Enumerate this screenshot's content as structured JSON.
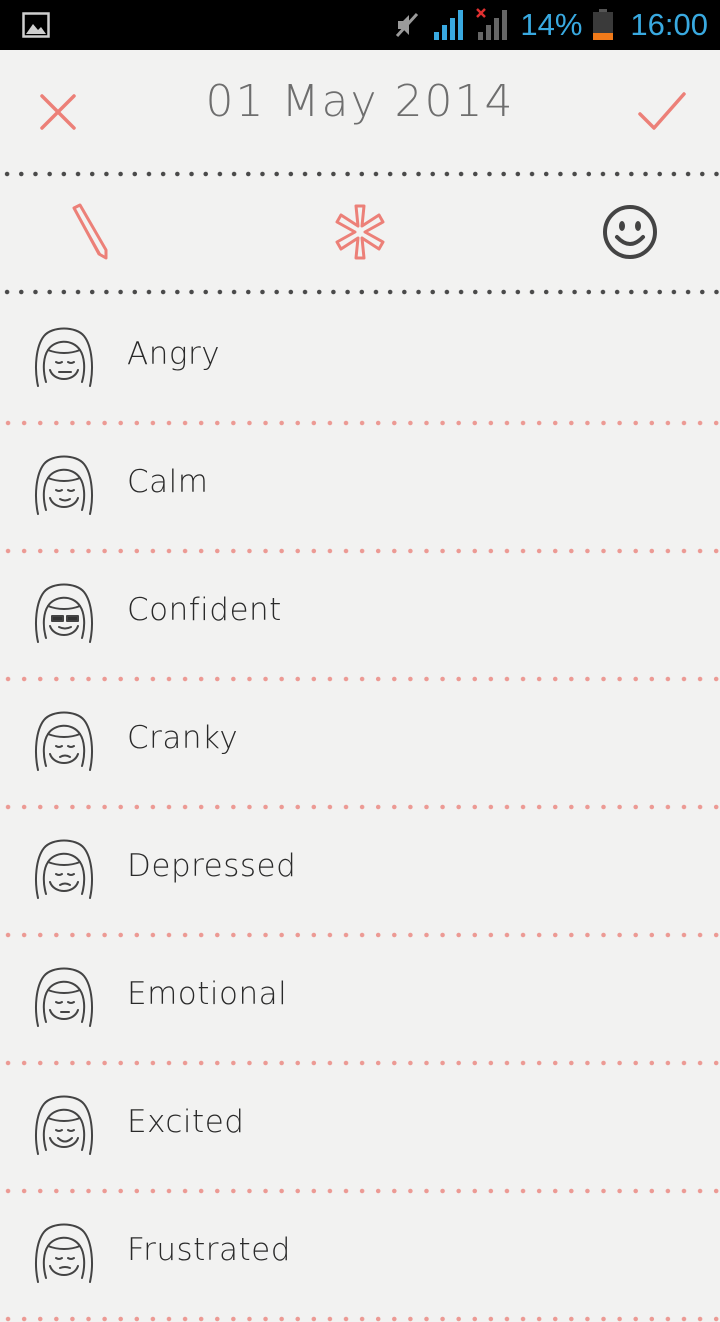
{
  "status_bar": {
    "battery_percent": "14%",
    "time": "16:00",
    "accent_color": "#39a9e0"
  },
  "header": {
    "date": "01 May 2014",
    "close_icon": "close-icon",
    "confirm_icon": "check-icon",
    "accent_color": "#ec8078"
  },
  "tabs": [
    {
      "icon": "pencil-icon"
    },
    {
      "icon": "asterisk-icon"
    },
    {
      "icon": "smiley-icon"
    }
  ],
  "moods": [
    {
      "label": "Angry",
      "icon": "angry-face-icon"
    },
    {
      "label": "Calm",
      "icon": "calm-face-icon"
    },
    {
      "label": "Confident",
      "icon": "confident-face-icon"
    },
    {
      "label": "Cranky",
      "icon": "cranky-face-icon"
    },
    {
      "label": "Depressed",
      "icon": "depressed-face-icon"
    },
    {
      "label": "Emotional",
      "icon": "emotional-face-icon"
    },
    {
      "label": "Excited",
      "icon": "excited-face-icon"
    },
    {
      "label": "Frustrated",
      "icon": "frustrated-face-icon"
    }
  ]
}
